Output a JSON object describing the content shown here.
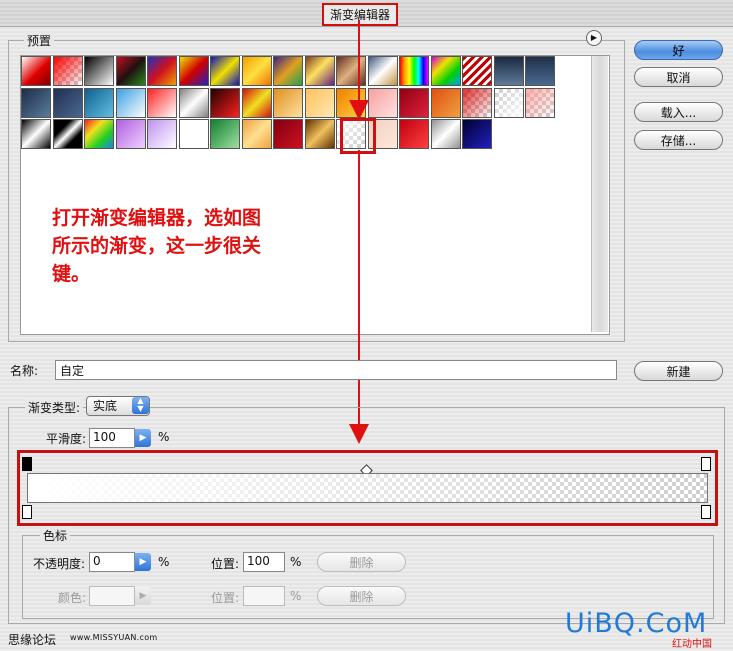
{
  "window": {
    "title": "渐变编辑器"
  },
  "presets": {
    "label": "预置",
    "swatches": [
      "linear-gradient(135deg,#ffffff,#e00000 55%,#800000)",
      "chk|linear-gradient(135deg,rgba(255,0,0,1),rgba(255,0,0,0))",
      "linear-gradient(135deg,#000,#fff)",
      "linear-gradient(135deg,#c01020,#201010,#2a8a20)",
      "linear-gradient(135deg,#2030c0,#d01020,#f0a000)",
      "linear-gradient(135deg,#f0e000,#d00000,#2020c0)",
      "linear-gradient(135deg,#1010c0,#f0e000 50%,#1010c0)",
      "linear-gradient(135deg,#f0a000,#ffe040,#f07000)",
      "linear-gradient(135deg,#402080,#e0a020,#20a050)",
      "linear-gradient(135deg,#804020,#ffe060 45%,#602080)",
      "linear-gradient(135deg,#603020,#e0b080 50%,#603020)",
      "linear-gradient(135deg,#405a80,#ffffff 50%,#c09040)",
      "linear-gradient(90deg,red,orange,yellow,lime,cyan,blue,magenta)",
      "linear-gradient(135deg,#d000d0,#f0e000,#00d000,#00a0f0)",
      "repeating-linear-gradient(135deg,#c00000 0 3px,#fff 3px 6px)",
      "linear-gradient(180deg,#1a2a40,#607a98)",
      "linear-gradient(180deg,#20304a,#4a6a90)",
      "linear-gradient(135deg,#1c2e48,#5a7ca0)",
      "linear-gradient(135deg,#203050,#4a6890)",
      "linear-gradient(135deg,#106090,#60c0e0)",
      "linear-gradient(135deg,#3aa0e0,#ffffff)",
      "linear-gradient(135deg,#ff2020,#ffffff)",
      "linear-gradient(135deg,#808080,#ffffff 50%,#808080)",
      "linear-gradient(135deg,#200000,#ff2020)",
      "linear-gradient(135deg,#d01010,#f0e020 50%,#d01010)",
      "linear-gradient(135deg,#e09020,#ffe0a0)",
      "linear-gradient(135deg,#ffc060,#ffe8b0)",
      "linear-gradient(135deg,#f08000,#ffd040)",
      "linear-gradient(135deg,#f8a0a0,#ffe0e0)",
      "linear-gradient(135deg,#900010,#e02040)",
      "linear-gradient(135deg,#e05010,#f0a040)",
      "chk|linear-gradient(135deg,rgba(220,0,0,0.8),rgba(255,255,255,0))",
      "chk|linear-gradient(135deg,rgba(255,255,255,0),rgba(255,255,255,0.9))",
      "chk|linear-gradient(135deg,rgba(255,150,150,0.8),rgba(255,255,255,0))",
      "linear-gradient(135deg,#000,#fff 50%,#000)",
      "linear-gradient(135deg,#000 30%,#fff 50%,#000 70%)",
      "linear-gradient(135deg,#f02020,#f0e020,#20d020,#2080f0)",
      "linear-gradient(135deg,#b060e0,#f0d0ff)",
      "linear-gradient(135deg,#c090f0,#ffffff)",
      "linear-gradient(135deg,#ffffff,#ffffff)",
      "linear-gradient(135deg,#108030,#a0e0a0)",
      "linear-gradient(135deg,#f0a040,#ffe090 50%,#f0a040)",
      "linear-gradient(135deg,#800010,#d01020)",
      "linear-gradient(135deg,#603000,#f0c060 50%,#603000)",
      "chk|linear-gradient(135deg,rgba(255,255,255,0.9),rgba(255,255,255,0))",
      "linear-gradient(135deg,#f0d0c0,#ffe8d8)",
      "linear-gradient(135deg,#c00010,#ff4040)",
      "linear-gradient(135deg,#909090,#ffffff 50%,#909090)",
      "linear-gradient(135deg,#000030,#2020c0)"
    ]
  },
  "annotation": {
    "line1": "打开渐变编辑器，选如图",
    "line2": "所示的渐变，这一步很关",
    "line3": "键。"
  },
  "buttons": {
    "ok": "好",
    "cancel": "取消",
    "load": "载入...",
    "save": "存储...",
    "new": "新建"
  },
  "name": {
    "label": "名称:",
    "value": "自定"
  },
  "gradient": {
    "type_label": "渐变类型:",
    "type_value": "实底",
    "smoothness_label": "平滑度:",
    "smoothness_value": "100",
    "percent": "%"
  },
  "color_stops": {
    "label": "色标",
    "opacity_label": "不透明度:",
    "opacity_value": "0",
    "location_label": "位置:",
    "location_value": "100",
    "delete_label": "删除",
    "color_label": "颜色:",
    "color_location_label": "位置:",
    "color_location_value": "",
    "percent": "%"
  },
  "footer": {
    "forum": "思缘论坛",
    "url": "www.MISSYUAN.com",
    "watermark": "UiBQ.CoM",
    "watermark_sub": "红动中国"
  }
}
